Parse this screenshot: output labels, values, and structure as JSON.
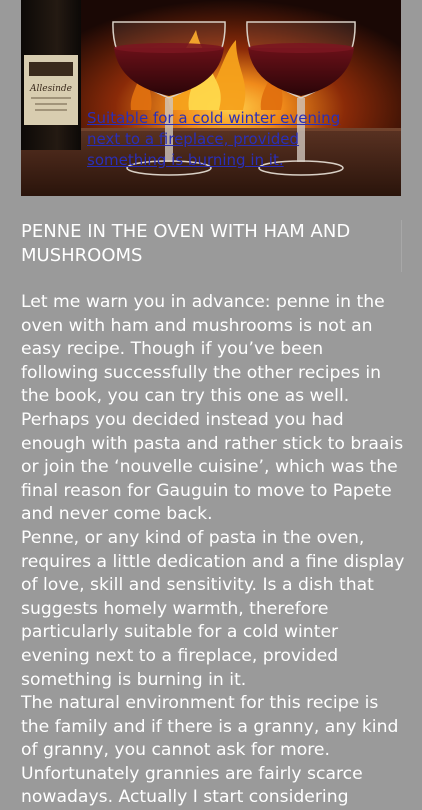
{
  "hero": {
    "caption": "Suitable for a cold winter evening next to a fireplace, provided something is burning in it.",
    "bottle_label_brand": "Allesinde",
    "colors": {
      "caption_link": "#2a2fb8",
      "background": "#9a9a9a",
      "wine": "#4a0b12",
      "fire": "#f08a1a"
    }
  },
  "recipe": {
    "title": "PENNE IN THE OVEN WITH HAM AND MUSHROOMS",
    "paragraphs": [
      "Let me warn you in advance: penne in the oven with ham and mushrooms is not an easy recipe.  Though if you’ve been following successfully the other recipes in the book, you can try this one as well. Perhaps you decided instead you had enough with pasta and rather stick to braais or join the ‘nouvelle cuisine’, which was the final reason for Gauguin to move to Papete and never come back.",
      "Penne, or any kind of pasta in the oven, requires a little dedication and a fine display of love, skill and sensitivity.  Is a dish that suggests homely warmth, therefore particularly suitable for a cold winter evening next to a fireplace, provided something is burning in it.",
      "The natural environment for this recipe is the family and if there is a granny, any kind of granny, you cannot ask for more. Unfortunately grannies are fairly scarce nowadays.  Actually I start considering"
    ]
  }
}
